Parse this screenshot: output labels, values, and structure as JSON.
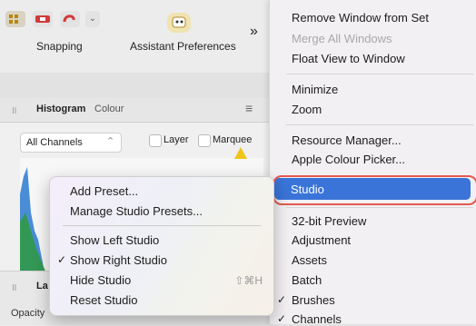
{
  "toolbar": {
    "snapping_label": "Snapping",
    "assistant_label": "Assistant Preferences",
    "overflow_icon": "»"
  },
  "histogram_panel": {
    "tabs": [
      "Histogram",
      "Colour"
    ],
    "channel_select": "All Channels",
    "layer_checkbox": "Layer",
    "marquee_checkbox": "Marquee"
  },
  "layers_panel": {
    "tab_partial": "La",
    "opacity_label": "Opacity"
  },
  "right_menu": {
    "items": [
      {
        "label": "Remove Window from Set",
        "enabled": true
      },
      {
        "label": "Merge All Windows",
        "enabled": false
      },
      {
        "label": "Float View to Window",
        "enabled": true
      },
      {
        "label": "Minimize",
        "enabled": true
      },
      {
        "label": "Zoom",
        "enabled": true
      },
      {
        "label": "Resource Manager...",
        "enabled": true
      },
      {
        "label": "Apple Colour Picker...",
        "enabled": true
      },
      {
        "label": "Studio",
        "enabled": true,
        "highlighted": true
      },
      {
        "label": "32-bit Preview",
        "enabled": true
      },
      {
        "label": "Adjustment",
        "enabled": true
      },
      {
        "label": "Assets",
        "enabled": true
      },
      {
        "label": "Batch",
        "enabled": true
      },
      {
        "label": "Brushes",
        "enabled": true,
        "checked": true
      },
      {
        "label": "Channels",
        "enabled": true,
        "checked": true
      }
    ]
  },
  "context_menu": {
    "items": [
      {
        "label": "Add Preset..."
      },
      {
        "label": "Manage Studio Presets..."
      },
      {
        "label": "Show Left Studio"
      },
      {
        "label": "Show Right Studio",
        "checked": true
      },
      {
        "label": "Hide Studio",
        "shortcut": "⇧⌘H"
      },
      {
        "label": "Reset Studio"
      }
    ]
  },
  "colors": {
    "highlight": "#3a74d8",
    "outline": "#e25b4f"
  }
}
